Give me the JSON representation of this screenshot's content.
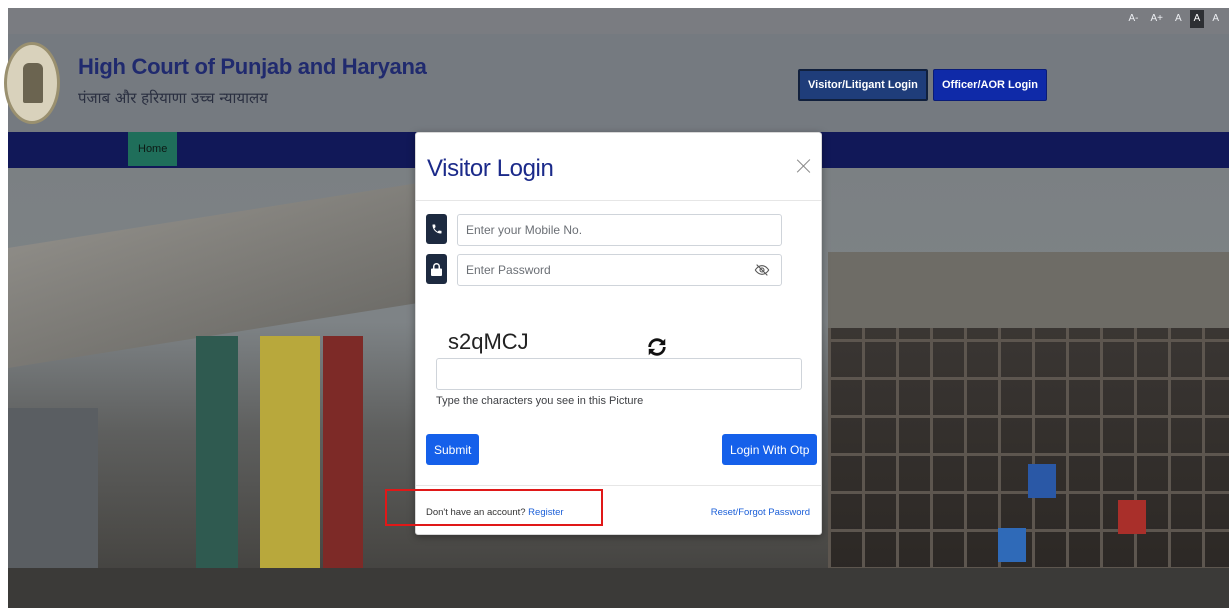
{
  "accessibility": {
    "font_sizes": [
      "A-",
      "A+",
      "A",
      "A",
      "A"
    ]
  },
  "header": {
    "title_en": "High Court of Punjab and Haryana",
    "title_hi": "पंजाब और हरियाणा उच्च न्यायालय",
    "visitor_login_label": "Visitor/Litigant Login",
    "officer_login_label": "Officer/AOR Login"
  },
  "nav": {
    "home_label": "Home"
  },
  "modal": {
    "title": "Visitor Login",
    "mobile_placeholder": "Enter your Mobile No.",
    "password_placeholder": "Enter Password",
    "captcha_text": "s2qMCJ",
    "captcha_hint": "Type the characters you see in this Picture",
    "submit_label": "Submit",
    "otp_label": "Login With Otp",
    "no_account_text": "Don't have an account? ",
    "register_label": "Register",
    "reset_label": "Reset/Forgot Password"
  },
  "colors": {
    "primary_blue": "#1560ea",
    "navbar": "#111858",
    "title_blue": "#1b2a8a",
    "highlight_red": "#e01818"
  }
}
